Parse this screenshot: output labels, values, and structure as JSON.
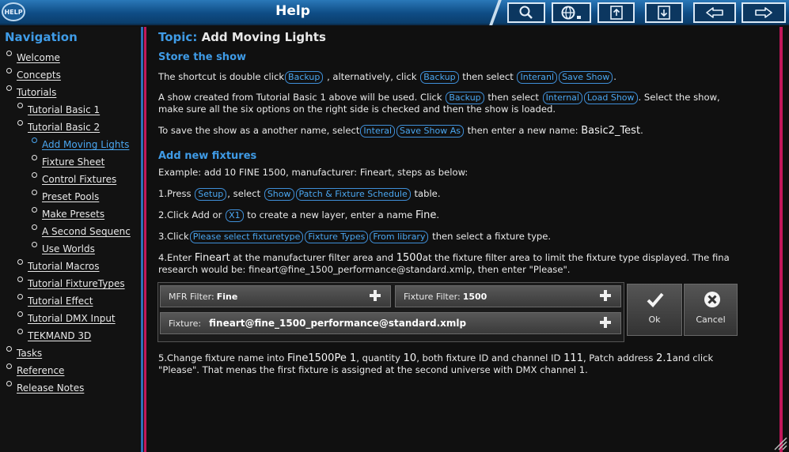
{
  "window": {
    "title": "Help",
    "logo_text": "HELP"
  },
  "toolbar": {
    "icons": [
      "search-icon",
      "globe-menu-icon",
      "export-icon",
      "import-icon",
      "back-arrow-icon",
      "forward-arrow-icon"
    ]
  },
  "sidebar": {
    "title": "Navigation",
    "items": [
      {
        "label": "Welcome",
        "level": 0
      },
      {
        "label": "Concepts",
        "level": 0
      },
      {
        "label": "Tutorials",
        "level": 0
      },
      {
        "label": "Tutorial Basic 1",
        "level": 1
      },
      {
        "label": "Tutorial Basic 2",
        "level": 1
      },
      {
        "label": "Add Moving Lights",
        "level": 2,
        "active": true
      },
      {
        "label": "Fixture Sheet",
        "level": 2
      },
      {
        "label": "Control Fixtures",
        "level": 2
      },
      {
        "label": "Preset Pools",
        "level": 2
      },
      {
        "label": "Make Presets",
        "level": 2
      },
      {
        "label": "A Second Sequenc",
        "level": 2
      },
      {
        "label": "Use Worlds",
        "level": 2
      },
      {
        "label": "Tutorial Macros",
        "level": 1
      },
      {
        "label": "Tutorial FixtureTypes",
        "level": 1
      },
      {
        "label": "Tutorial Effect",
        "level": 1
      },
      {
        "label": "Tutorial DMX Input",
        "level": 1
      },
      {
        "label": "TEKMAND 3D",
        "level": 1
      },
      {
        "label": "Tasks",
        "level": 0
      },
      {
        "label": "Reference",
        "level": 0
      },
      {
        "label": "Release Notes",
        "level": 0
      }
    ]
  },
  "content": {
    "topic_label": "Topic:",
    "topic_title": "Add Moving Lights",
    "section1": "Store the show",
    "p1": {
      "t1": "The shortcut is double click",
      "b1": "Backup",
      "t2": ", alternatively, click",
      "b2": "Backup",
      "t3": "then select",
      "b3": "Interanl",
      "b4": "Save Show",
      "t4": "."
    },
    "p2": {
      "t1": "A show created from Tutorial Basic 1 above will be used. Click",
      "b1": "Backup",
      "t2": "then select",
      "b2": "Internal",
      "b3": "Load Show",
      "t3": ". Select the show,",
      "line2": "make sure all the six options on the right side is checked and then the show is loaded."
    },
    "p3": {
      "t1": "To save the show as a another name, select",
      "b1": "Interal",
      "b2": "Save Show As",
      "t2": "then enter a new name:",
      "name": "Basic2_Test",
      "t3": "."
    },
    "section2": "Add new fixtures",
    "p4": "Example: add 10 FINE 1500, manufacturer: Fineart, steps as below:",
    "s1": {
      "t1": "1.Press",
      "b1": "Setup",
      "t2": ", select",
      "b2": "Show",
      "b3": "Patch & Fixture Schedule",
      "t3": "table."
    },
    "s2": {
      "t1": "2.Click Add or",
      "b1": "X1",
      "t2": "to create a new layer, enter a name",
      "name": "Fine",
      "t3": "."
    },
    "s3": {
      "t1": "3.Click",
      "b1": "Please select fixturetype",
      "b2": "Fixture Types",
      "b3": "From library",
      "t2": "then select a fixture type."
    },
    "s4": {
      "t1": "4.Enter",
      "v1": "Fineart",
      "t2": "at the manufacturer filter area and",
      "v2": "1500",
      "t3": "at the fixture filter area to limit the fixture type displayed. The fina",
      "line2": "research would be: fineart@fine_1500_performance@standard.xmlp, then enter \"Please\"."
    },
    "panel": {
      "mfr_label": "MFR Filter:",
      "mfr_value": "Fine",
      "fixture_filter_label": "Fixture Filter:",
      "fixture_filter_value": "1500",
      "fixture_label": "Fixture:",
      "fixture_value": "fineart@fine_1500_performance@standard.xmlp",
      "ok_label": "Ok",
      "cancel_label": "Cancel"
    },
    "s5": {
      "t1": "5.Change fixture name into",
      "v1": "Fine1500Pe 1",
      "t2": ", quantity",
      "v2": "10",
      "t3": ", both fixture ID and channel ID",
      "v3": "111",
      "t4": ", Patch address",
      "v4": "2.1",
      "t5": "and click",
      "line2": "\"Please\". That menas the first fixture is assigned at the second universe with DMX channel 1."
    }
  },
  "colors": {
    "titlebar": "#1660a0",
    "accent": "#3f9be6",
    "background": "#101010",
    "divider_left": "#2e6fb8",
    "divider_right": "#c2185b"
  }
}
